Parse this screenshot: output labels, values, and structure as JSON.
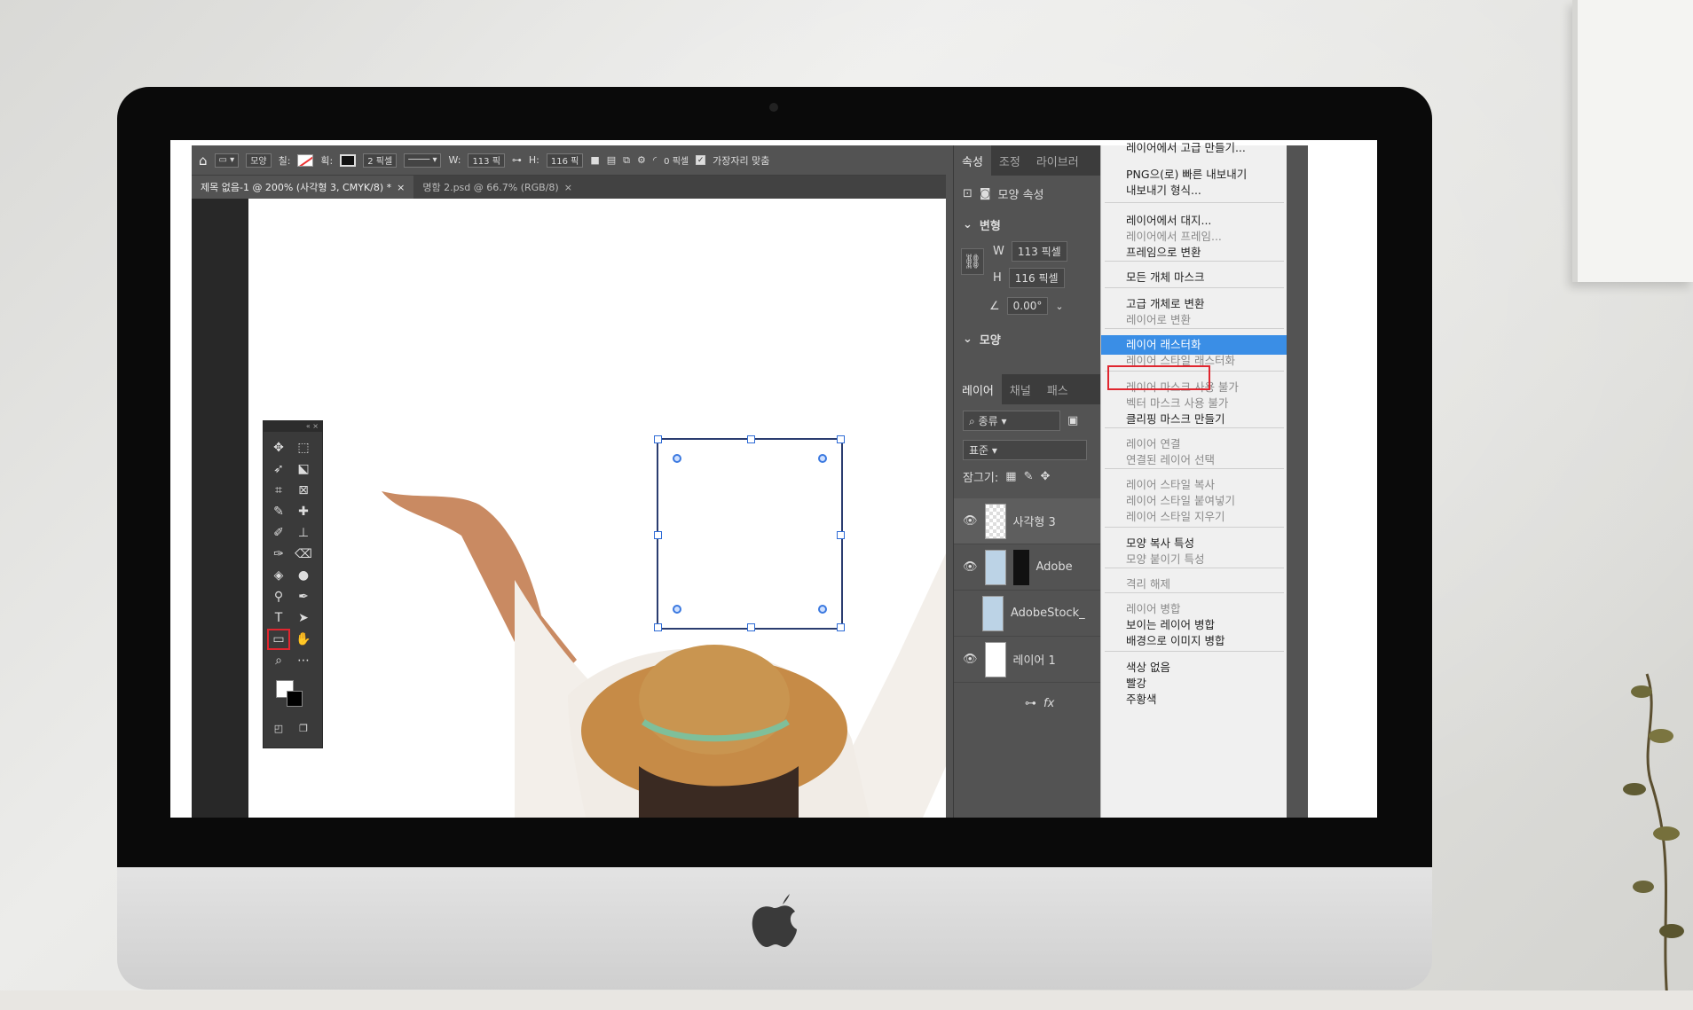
{
  "options_bar": {
    "shape_mode": "모양",
    "fill_label": "칠:",
    "stroke_label": "획:",
    "stroke_width": "2 픽셀",
    "w_label": "W:",
    "w_value": "113 픽",
    "h_label": "H:",
    "h_value": "116 픽",
    "radius": "0 픽셀",
    "align_edges": "가장자리 맞춤"
  },
  "doc_tabs": [
    {
      "label": "제목 없음-1 @ 200% (사각형 3, CMYK/8) *"
    },
    {
      "label": "명함 2.psd @ 66.7% (RGB/8)"
    }
  ],
  "properties": {
    "tabs": [
      "속성",
      "조정",
      "라이브러"
    ],
    "header": "모양 속성",
    "transform_title": "변형",
    "w_label": "W",
    "w_value": "113 픽셀",
    "h_label": "H",
    "h_value": "116 픽셀",
    "angle": "0.00°",
    "shape_title": "모양"
  },
  "layers": {
    "tabs": [
      "레이어",
      "채널",
      "패스"
    ],
    "filter": "종류",
    "blend": "표준",
    "lock_label": "잠그기:",
    "rows": [
      {
        "name": "사각형 3"
      },
      {
        "name": "Adobe"
      },
      {
        "name": "AdobeStock_"
      },
      {
        "name": "레이어 1"
      }
    ]
  },
  "context_menu": {
    "items": [
      {
        "label": "레이어에서 고급 만들기...",
        "disabled": false
      },
      {
        "label": "PNG으(로) 빠른 내보내기",
        "disabled": false
      },
      {
        "label": "내보내기 형식...",
        "disabled": false
      },
      {
        "label": "레이어에서 대지...",
        "disabled": false
      },
      {
        "label": "레이어에서 프레임...",
        "disabled": true
      },
      {
        "label": "프레임으로 변환",
        "disabled": false
      },
      {
        "label": "모든 개체 마스크",
        "disabled": false
      },
      {
        "label": "고급 개체로 변환",
        "disabled": false
      },
      {
        "label": "레이어로 변환",
        "disabled": true
      },
      {
        "label": "레이어 래스터화",
        "disabled": false,
        "highlighted": true
      },
      {
        "label": "레이어 스타일 래스터화",
        "disabled": true
      },
      {
        "label": "레이어 마스크 사용 불가",
        "disabled": true
      },
      {
        "label": "벡터 마스크 사용 불가",
        "disabled": true
      },
      {
        "label": "클리핑 마스크 만들기",
        "disabled": false
      },
      {
        "label": "레이어 연결",
        "disabled": true
      },
      {
        "label": "연결된 레이어 선택",
        "disabled": true
      },
      {
        "label": "레이어 스타일 복사",
        "disabled": true
      },
      {
        "label": "레이어 스타일 붙여넣기",
        "disabled": true
      },
      {
        "label": "레이어 스타일 지우기",
        "disabled": true
      },
      {
        "label": "모양 복사 특성",
        "disabled": false
      },
      {
        "label": "모양 붙이기 특성",
        "disabled": true
      },
      {
        "label": "격리 해제",
        "disabled": true
      },
      {
        "label": "레이어 병합",
        "disabled": true
      },
      {
        "label": "보이는 레이어 병합",
        "disabled": false
      },
      {
        "label": "배경으로 이미지 병합",
        "disabled": false
      },
      {
        "label": "색상 없음",
        "disabled": false
      },
      {
        "label": "빨강",
        "disabled": false
      },
      {
        "label": "주황색",
        "disabled": false
      }
    ]
  },
  "colors": {
    "highlight": "#3a8ee6",
    "callout": "#e0262f",
    "ps_panel": "#535353"
  }
}
